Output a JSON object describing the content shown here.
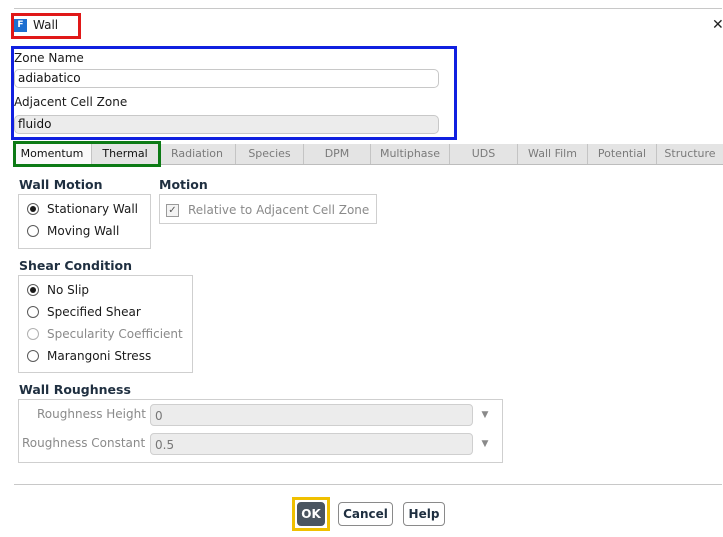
{
  "window": {
    "title": "Wall",
    "app_icon_letter": "F",
    "close_glyph": "✕"
  },
  "zone": {
    "name_label": "Zone Name",
    "name_value": "adiabatico",
    "adjacent_label": "Adjacent Cell Zone",
    "adjacent_value": "fluido"
  },
  "tabs": [
    "Momentum",
    "Thermal",
    "Radiation",
    "Species",
    "DPM",
    "Multiphase",
    "UDS",
    "Wall Film",
    "Potential",
    "Structure"
  ],
  "active_tab": "Momentum",
  "wall_motion": {
    "title": "Wall Motion",
    "options": [
      "Stationary Wall",
      "Moving Wall"
    ],
    "selected": "Stationary Wall"
  },
  "motion": {
    "title": "Motion",
    "relative_label": "Relative to Adjacent Cell Zone",
    "relative_checked": true
  },
  "shear": {
    "title": "Shear Condition",
    "options": [
      "No Slip",
      "Specified Shear",
      "Specularity Coefficient",
      "Marangoni Stress"
    ],
    "selected": "No Slip"
  },
  "roughness": {
    "title": "Wall Roughness",
    "height_label": "Roughness Height (m)",
    "height_value": "0",
    "constant_label": "Roughness Constant",
    "constant_value": "0.5"
  },
  "buttons": {
    "ok": "OK",
    "cancel": "Cancel",
    "help": "Help"
  },
  "colors": {
    "title_highlight": "#e01818",
    "zone_highlight": "#1020e0",
    "tabs_highlight": "#0c7a15",
    "ok_highlight": "#f0c000",
    "app_icon": "#1e6fd0"
  }
}
